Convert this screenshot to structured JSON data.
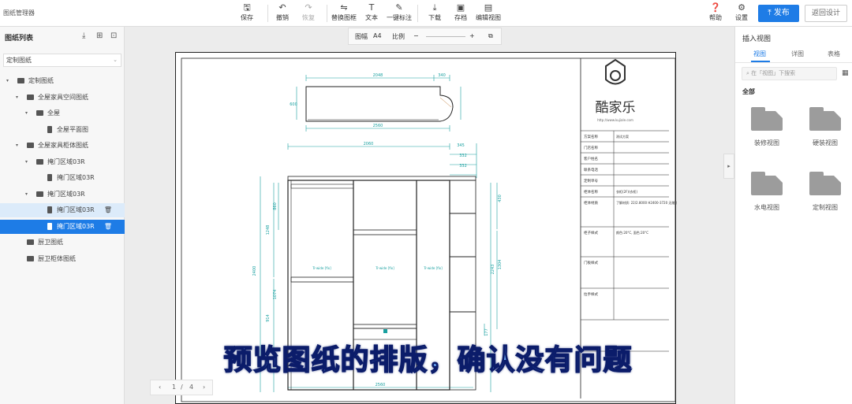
{
  "app": {
    "title": "图纸管理器"
  },
  "toolbar": {
    "save": "保存",
    "undo": "撤销",
    "redo": "恢复",
    "replace_frame": "替换图框",
    "text": "文本",
    "auto_annotate": "一键标注",
    "download": "下载",
    "archive": "存档",
    "edit_view": "编辑视图",
    "help": "帮助",
    "settings": "设置",
    "publish": "发布",
    "back_design": "返回设计"
  },
  "left_panel": {
    "title": "图纸列表",
    "select_value": "定制图纸",
    "tree": [
      {
        "label": "定制图纸",
        "level": 0,
        "type": "folder",
        "expanded": true
      },
      {
        "label": "全屋家具空间图纸",
        "level": 1,
        "type": "folder",
        "expanded": true
      },
      {
        "label": "全屋",
        "level": 2,
        "type": "folder",
        "expanded": true
      },
      {
        "label": "全屋平面图",
        "level": 3,
        "type": "file"
      },
      {
        "label": "全屋家具柜体图纸",
        "level": 1,
        "type": "folder",
        "expanded": true
      },
      {
        "label": "掩门区域03R",
        "level": 2,
        "type": "folder",
        "expanded": true
      },
      {
        "label": "掩门区域03R",
        "level": 3,
        "type": "file"
      },
      {
        "label": "掩门区域03R",
        "level": 2,
        "type": "folder",
        "expanded": true
      },
      {
        "label": "掩门区域03R",
        "level": 3,
        "type": "file",
        "state": "hover"
      },
      {
        "label": "掩门区域03R",
        "level": 3,
        "type": "file",
        "state": "selected"
      },
      {
        "label": "厨卫图纸",
        "level": 1,
        "type": "folder"
      },
      {
        "label": "厨卫柜体图纸",
        "level": 1,
        "type": "folder"
      }
    ]
  },
  "view_bar": {
    "frame_label": "图幅",
    "frame_value": "A4",
    "scale_label": "比例",
    "minus": "−",
    "plus": "+"
  },
  "pager": {
    "prev": "‹",
    "current": "1",
    "slash": "/",
    "total": "4",
    "next": "›"
  },
  "drawing": {
    "brand": "酷家乐",
    "brand_url": "http://www.kujiale.com",
    "title_block": [
      {
        "label": "方案名称",
        "value": "测试方案"
      },
      {
        "label": "门店名称",
        "value": ""
      },
      {
        "label": "客户姓名",
        "value": ""
      },
      {
        "label": "联系电话",
        "value": ""
      },
      {
        "label": "定制单号",
        "value": ""
      },
      {
        "label": "柜体名称",
        "value": "衣柜(2F)(衣柜)"
      },
      {
        "label": "柜体材质",
        "value": "了解材质: 22/2.8000 H2400-3720 无缝纹质"
      },
      {
        "label": "柜子样式",
        "value": "颜色:20°C, 面色:20°C"
      },
      {
        "label": "门板样式",
        "value": ""
      },
      {
        "label": "拉手样式",
        "value": ""
      }
    ],
    "dims": {
      "plan_width": "2560",
      "plan_a": "2048",
      "plan_b": "340",
      "plan_depth": "600",
      "elev_top": "2060",
      "elev_r1": "345",
      "elev_r2": "332",
      "elev_r3": "332",
      "h_total": "2400",
      "h_upper": "1248",
      "h_a": "860",
      "h_mid": "1074",
      "h_low": "914",
      "r_a": "430",
      "r_b": "1304",
      "r_c": "2243",
      "r_d": "177",
      "bottom": "2560",
      "label1": "Tr-wide [fix]",
      "label2": "Tr-wide [fix]",
      "label3": "Tr-wide [fix]"
    }
  },
  "subtitle": "预览图纸的排版，确认没有问题",
  "right_panel": {
    "title": "插入视图",
    "tabs": [
      "视图",
      "详图",
      "表格"
    ],
    "search_placeholder": "在「视图」下搜索",
    "all_label": "全部",
    "tiles": [
      "装修视图",
      "硬装视图",
      "水电视图",
      "定制视图"
    ]
  },
  "colors": {
    "accent": "#1e7ce6",
    "dimension": "#19a0a0",
    "subtitle_fill": "#6fb1ff",
    "subtitle_stroke": "#0b1c6a"
  }
}
